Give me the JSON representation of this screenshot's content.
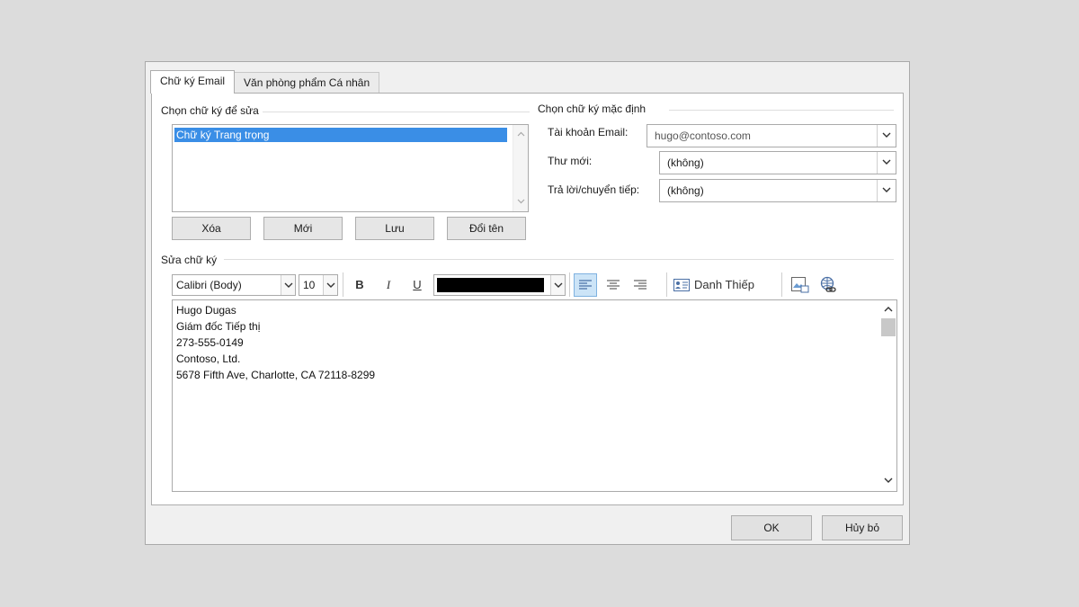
{
  "tabs": [
    {
      "label": "Chữ ký Email",
      "active": true
    },
    {
      "label": "Văn phòng phẩm Cá nhân",
      "active": false
    }
  ],
  "select_section": {
    "label": "Chọn chữ ký để sửa",
    "items": [
      "Chữ ký Trang trọng"
    ],
    "buttons": {
      "delete": "Xóa",
      "new": "Mới",
      "save": "Lưu",
      "rename": "Đổi tên"
    }
  },
  "default_section": {
    "label": "Chọn chữ ký mặc định",
    "account_label": "Tài khoản Email:",
    "account_value": "hugo@contoso.com",
    "new_messages_label": "Thư mới:",
    "new_messages_value": "(không)",
    "replies_label": "Trả lời/chuyển tiếp:",
    "replies_value": "(không)"
  },
  "edit_section": {
    "label": "Sửa chữ ký",
    "font": "Calibri (Body)",
    "size": "10",
    "bold": "B",
    "italic": "I",
    "underline": "U",
    "text_color": "#000000",
    "business_card_label": "Danh Thiếp",
    "lines": [
      "Hugo Dugas",
      "Giám đốc Tiếp thị",
      "273-555-0149",
      "Contoso, Ltd.",
      "5678 Fifth Ave, Charlotte, CA 72118-8299"
    ]
  },
  "footer": {
    "ok": "OK",
    "cancel": "Hủy bỏ"
  },
  "colors": {
    "selection": "#3a8ee6",
    "accent_button": "#cce4f7"
  },
  "icons": [
    "chevron-down-icon",
    "scroll-up-icon",
    "scroll-down-icon",
    "business-card-icon",
    "insert-picture-icon",
    "hyperlink-icon"
  ]
}
